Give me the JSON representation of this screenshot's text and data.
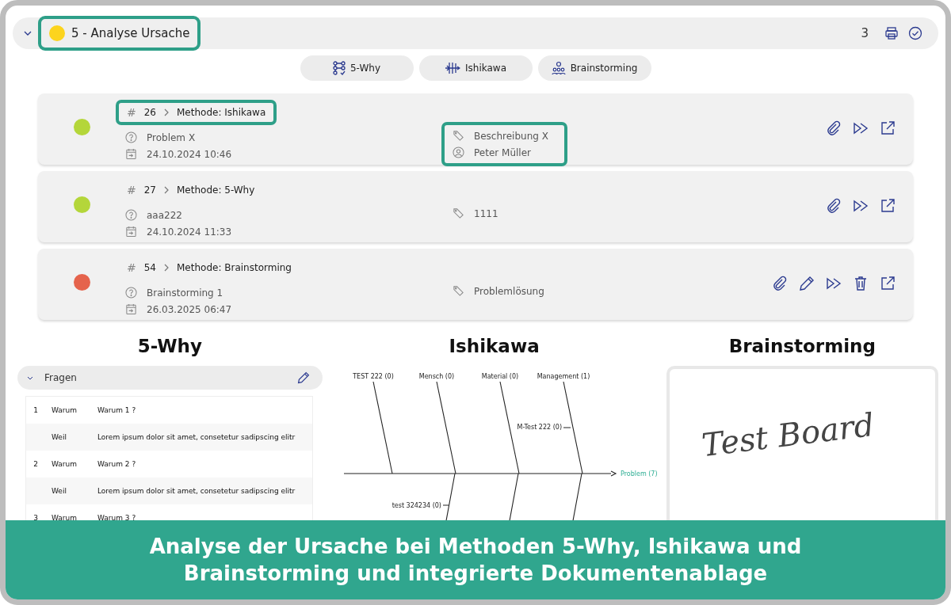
{
  "header": {
    "title": "5 - Analyse Ursache",
    "color": "#fcd41e",
    "count": "3",
    "highlighted": true
  },
  "methods": [
    {
      "label": "5-Why",
      "kind": "why"
    },
    {
      "label": "Ishikawa",
      "kind": "fishbone"
    },
    {
      "label": "Brainstorming",
      "kind": "brainstorm"
    }
  ],
  "entries": [
    {
      "prefix": "#",
      "number": "26",
      "method": "Methode: Ishikawa",
      "color": "#b4d63a",
      "problem": "Problem X",
      "date": "24.10.2024 10:46",
      "tag": "Beschreibung X",
      "person": "Peter Müller",
      "highlight_title": true,
      "highlight_info": true,
      "actions": [
        {
          "kind": "attach"
        },
        {
          "kind": "forward"
        },
        {
          "kind": "open"
        }
      ]
    },
    {
      "prefix": "#",
      "number": "27",
      "method": "Methode: 5-Why",
      "color": "#b4d63a",
      "problem": "aaa222",
      "date": "24.10.2024 11:33",
      "tag": "1111",
      "highlight_title": false,
      "highlight_info": false,
      "actions": [
        {
          "kind": "attach"
        },
        {
          "kind": "forward"
        },
        {
          "kind": "open"
        }
      ]
    },
    {
      "prefix": "#",
      "number": "54",
      "method": "Methode: Brainstorming",
      "color": "#e5634c",
      "problem": "Brainstorming 1",
      "date": "26.03.2025 06:47",
      "tag": "Problemlösung",
      "highlight_title": false,
      "highlight_info": false,
      "actions": [
        {
          "kind": "attach"
        },
        {
          "kind": "edit"
        },
        {
          "kind": "forward"
        },
        {
          "kind": "delete"
        },
        {
          "kind": "open"
        }
      ]
    }
  ],
  "five_why": {
    "heading": "5-Why",
    "panel_title": "Fragen",
    "rows": [
      {
        "number": "1",
        "label": "Warum",
        "text": "Warum 1 ?"
      },
      {
        "label": "Weil",
        "text": "Lorem ipsum dolor sit amet, consetetur sadipscing elitr"
      },
      {
        "number": "2",
        "label": "Warum",
        "text": "Warum 2 ?"
      },
      {
        "label": "Weil",
        "text": "Lorem ipsum dolor sit amet, consetetur sadipscing elitr"
      },
      {
        "number": "3",
        "label": "Warum",
        "text": "Warum 3 ?"
      }
    ]
  },
  "ishikawa": {
    "heading": "Ishikawa",
    "problem": "Problem (7)",
    "causes": [
      {
        "label": "TEST 222 (0)"
      },
      {
        "label": "Mensch (0)"
      },
      {
        "label": "Material (0)"
      },
      {
        "label": "Management (1)",
        "sub": "M-Test 222 (0)"
      }
    ],
    "lower_labels": [
      "test 324234 (0)"
    ]
  },
  "brainstorming": {
    "heading": "Brainstorming",
    "board_text": "Test Board"
  },
  "caption": [
    "Analyse der Ursache bei Methoden 5-Why, Ishikawa und",
    "Brainstorming und integrierte Dokumentenablage"
  ]
}
